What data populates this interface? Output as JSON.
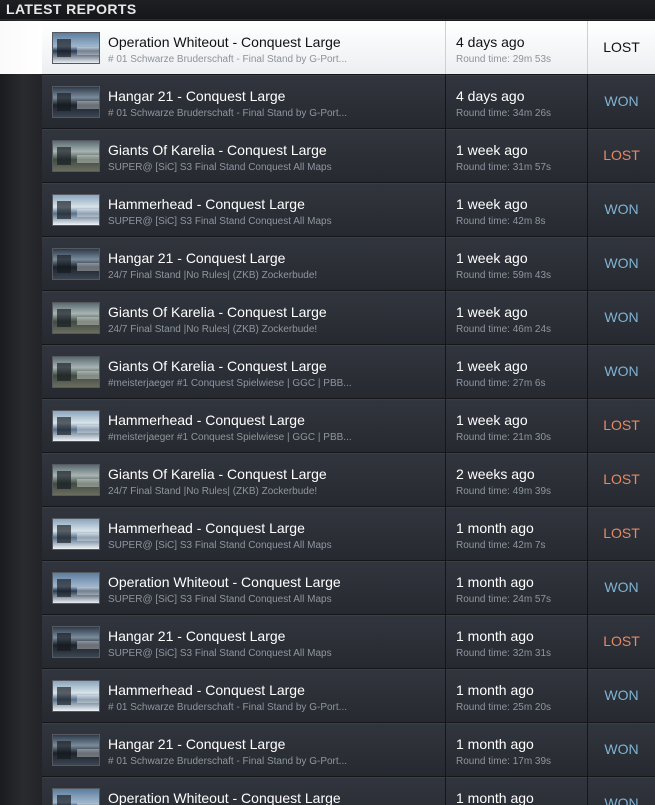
{
  "header": {
    "title": "LATEST REPORTS"
  },
  "rows": [
    {
      "map": "Operation Whiteout - Conquest Large",
      "server": "# 01 Schwarze Bruderschaft - Final Stand by G-Port...",
      "ago": "4 days ago",
      "round_time": "Round time: 29m 53s",
      "result": "LOST",
      "thumb": "whiteout",
      "active": true
    },
    {
      "map": "Hangar 21 - Conquest Large",
      "server": "# 01 Schwarze Bruderschaft - Final Stand by G-Port...",
      "ago": "4 days ago",
      "round_time": "Round time: 34m 26s",
      "result": "WON",
      "thumb": "hangar"
    },
    {
      "map": "Giants Of Karelia - Conquest Large",
      "server": "SUPER@ [SiC] S3 Final Stand Conquest All Maps",
      "ago": "1 week ago",
      "round_time": "Round time: 31m 57s",
      "result": "LOST",
      "thumb": "karelia"
    },
    {
      "map": "Hammerhead - Conquest Large",
      "server": "SUPER@ [SiC] S3 Final Stand Conquest All Maps",
      "ago": "1 week ago",
      "round_time": "Round time: 42m 8s",
      "result": "WON",
      "thumb": "hammer"
    },
    {
      "map": "Hangar 21 - Conquest Large",
      "server": "24/7 Final Stand |No Rules| (ZKB) Zockerbude!",
      "ago": "1 week ago",
      "round_time": "Round time: 59m 43s",
      "result": "WON",
      "thumb": "hangar"
    },
    {
      "map": "Giants Of Karelia - Conquest Large",
      "server": "24/7 Final Stand |No Rules| (ZKB) Zockerbude!",
      "ago": "1 week ago",
      "round_time": "Round time: 46m 24s",
      "result": "WON",
      "thumb": "karelia"
    },
    {
      "map": "Giants Of Karelia - Conquest Large",
      "server": "#meisterjaeger #1 Conquest Spielwiese | GGC | PBB...",
      "ago": "1 week ago",
      "round_time": "Round time: 27m 6s",
      "result": "WON",
      "thumb": "karelia"
    },
    {
      "map": "Hammerhead - Conquest Large",
      "server": "#meisterjaeger #1 Conquest Spielwiese | GGC | PBB...",
      "ago": "1 week ago",
      "round_time": "Round time: 21m 30s",
      "result": "LOST",
      "thumb": "hammer"
    },
    {
      "map": "Giants Of Karelia - Conquest Large",
      "server": "24/7 Final Stand |No Rules| (ZKB) Zockerbude!",
      "ago": "2 weeks ago",
      "round_time": "Round time: 49m 39s",
      "result": "LOST",
      "thumb": "karelia"
    },
    {
      "map": "Hammerhead - Conquest Large",
      "server": "SUPER@ [SiC] S3 Final Stand Conquest All Maps",
      "ago": "1 month ago",
      "round_time": "Round time: 42m 7s",
      "result": "LOST",
      "thumb": "hammer"
    },
    {
      "map": "Operation Whiteout - Conquest Large",
      "server": "SUPER@ [SiC] S3 Final Stand Conquest All Maps",
      "ago": "1 month ago",
      "round_time": "Round time: 24m 57s",
      "result": "WON",
      "thumb": "whiteout"
    },
    {
      "map": "Hangar 21 - Conquest Large",
      "server": "SUPER@ [SiC] S3 Final Stand Conquest All Maps",
      "ago": "1 month ago",
      "round_time": "Round time: 32m 31s",
      "result": "LOST",
      "thumb": "hangar"
    },
    {
      "map": "Hammerhead - Conquest Large",
      "server": "# 01 Schwarze Bruderschaft - Final Stand by G-Port...",
      "ago": "1 month ago",
      "round_time": "Round time: 25m 20s",
      "result": "WON",
      "thumb": "hammer"
    },
    {
      "map": "Hangar 21 - Conquest Large",
      "server": "# 01 Schwarze Bruderschaft - Final Stand by G-Port...",
      "ago": "1 month ago",
      "round_time": "Round time: 17m 39s",
      "result": "WON",
      "thumb": "hangar"
    },
    {
      "map": "Operation Whiteout - Conquest Large",
      "server": "",
      "ago": "1 month ago",
      "round_time": "",
      "result": "WON",
      "thumb": "whiteout"
    }
  ]
}
